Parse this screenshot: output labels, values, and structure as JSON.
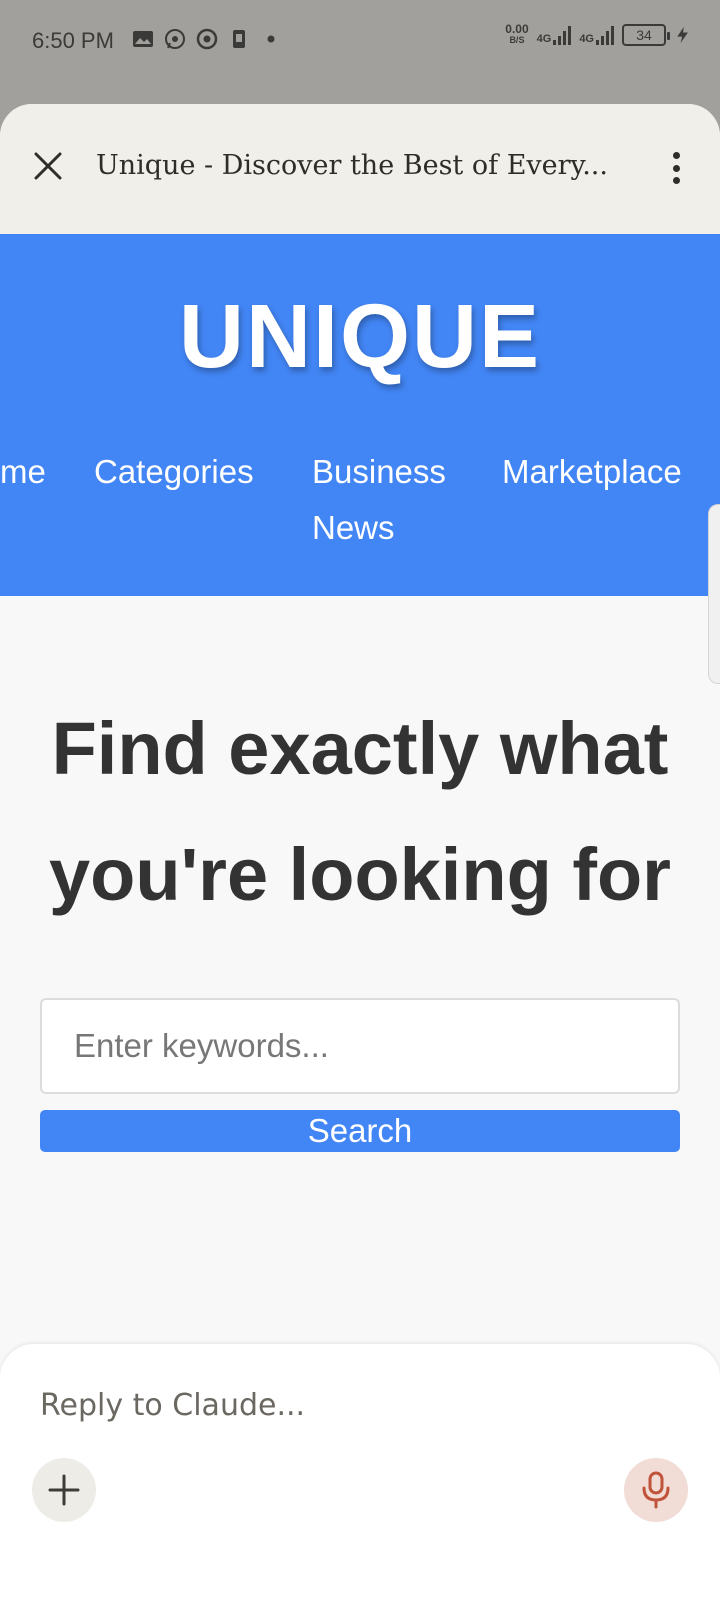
{
  "status_bar": {
    "time": "6:50 PM",
    "speed_value": "0.00",
    "speed_unit": "B/S",
    "network1": "4G",
    "network2": "4G",
    "battery": "34",
    "icons": [
      "gallery-icon",
      "whatsapp-icon",
      "chrome-icon",
      "sim-icon",
      "dot-icon",
      "signal-icon",
      "battery-icon",
      "charging-icon"
    ]
  },
  "sheet": {
    "title": "Unique - Discover the Best of Every..."
  },
  "site": {
    "logo": "UNIQUE",
    "nav": [
      "me",
      "Categories",
      "Business News",
      "Marketplace"
    ],
    "hero_title": "Find exactly what you're looking for",
    "search_placeholder": "Enter keywords...",
    "search_button": "Search"
  },
  "reply": {
    "placeholder": "Reply to Claude..."
  },
  "colors": {
    "brand_blue": "#4285f4",
    "sheet_header": "#f1efe9",
    "mic_accent": "#c0533a"
  }
}
